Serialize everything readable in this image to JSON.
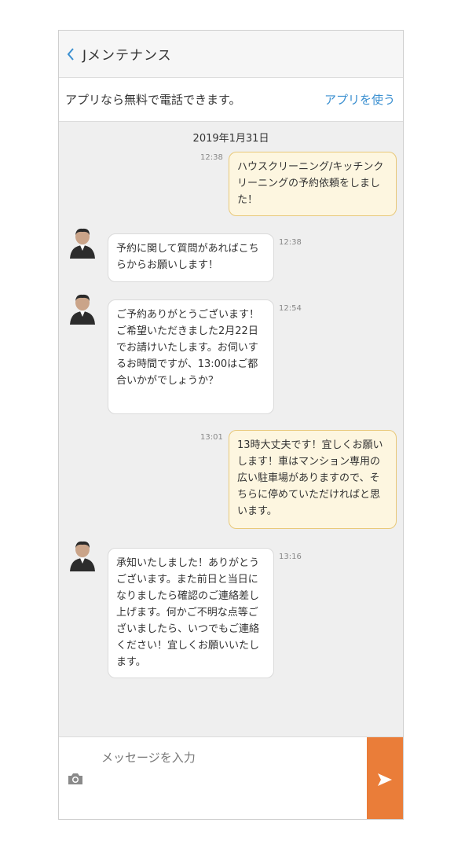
{
  "header": {
    "back_icon": "chevron-left-icon",
    "title": "Jメンテナンス"
  },
  "promo": {
    "text": "アプリなら無料で電話できます。",
    "link": "アプリを使う"
  },
  "chat": {
    "date": "2019年1月31日",
    "messages": [
      {
        "from": "user",
        "time": "12:38",
        "text": "ハウスクリーニング/キッチンクリーニングの予約依頼をしました！"
      },
      {
        "from": "agent",
        "time": "12:38",
        "text": "予約に関して質問があればこちらからお願いします！"
      },
      {
        "from": "agent",
        "time": "12:54",
        "text": "ご予約ありがとうございます！ご希望いただきました2月22日でお請けいたします。お伺いするお時間ですが、13:00はご都合いかがでしょうか？"
      },
      {
        "from": "user",
        "time": "13:01",
        "text": "13時大丈夫です！宜しくお願いします！車はマンション専用の広い駐車場がありますので、そちらに停めていただければと思います。"
      },
      {
        "from": "agent",
        "time": "13:16",
        "text": "承知いたしました！ありがとうございます。また前日と当日になりましたら確認のご連絡差し上げます。何かご不明な点等ございましたら、いつでもご連絡ください！宜しくお願いいたします。"
      }
    ]
  },
  "composer": {
    "placeholder": "メッセージを入力",
    "camera_icon": "camera-icon",
    "send_icon": "send-icon"
  },
  "colors": {
    "accent": "#3a8fd0",
    "send": "#ea7d39",
    "user_bubble": "#fdf6e0",
    "user_border": "#e8c879"
  }
}
